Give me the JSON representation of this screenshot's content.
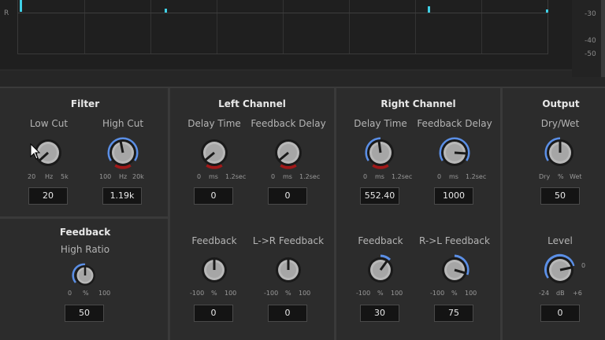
{
  "display": {
    "channel_label": "R",
    "scale_labels": [
      "-30",
      "-40",
      "-50"
    ]
  },
  "colors": {
    "accent_blue": "#5b8fe6",
    "accent_red": "#a01818",
    "marker_cyan": "#3fd0e6",
    "value_bg": "#141414"
  },
  "filter": {
    "title": "Filter",
    "low_cut": {
      "label": "Low Cut",
      "ticks": [
        "20",
        "Hz",
        "5k"
      ],
      "value": "20"
    },
    "high_cut": {
      "label": "High Cut",
      "ticks": [
        "100",
        "Hz",
        "20k"
      ],
      "value": "1.19k"
    }
  },
  "feedback_panel": {
    "title": "Feedback",
    "high_ratio": {
      "label": "High Ratio",
      "ticks": [
        "0",
        "%",
        "100"
      ],
      "value": "50"
    }
  },
  "left_channel": {
    "title": "Left Channel",
    "delay_time": {
      "label": "Delay Time",
      "ticks": [
        "0",
        "ms",
        "1.2sec"
      ],
      "value": "0"
    },
    "feedback_delay": {
      "label": "Feedback Delay",
      "ticks": [
        "0",
        "ms",
        "1.2sec"
      ],
      "value": "0"
    },
    "feedback": {
      "label": "Feedback",
      "ticks": [
        "-100",
        "%",
        "100"
      ],
      "value": "0"
    },
    "lr_feedback": {
      "label": "L->R Feedback",
      "ticks": [
        "-100",
        "%",
        "100"
      ],
      "value": "0"
    }
  },
  "right_channel": {
    "title": "Right Channel",
    "delay_time": {
      "label": "Delay Time",
      "ticks": [
        "0",
        "ms",
        "1.2sec"
      ],
      "value": "552.40"
    },
    "feedback_delay": {
      "label": "Feedback Delay",
      "ticks": [
        "0",
        "ms",
        "1.2sec"
      ],
      "value": "1000"
    },
    "feedback": {
      "label": "Feedback",
      "ticks": [
        "-100",
        "%",
        "100"
      ],
      "value": "30"
    },
    "rl_feedback": {
      "label": "R->L Feedback",
      "ticks": [
        "-100",
        "%",
        "100"
      ],
      "value": "75"
    }
  },
  "output": {
    "title": "Output",
    "dry_wet": {
      "label": "Dry/Wet",
      "ticks": [
        "Dry",
        "%",
        "Wet"
      ],
      "value": "50"
    },
    "level": {
      "label": "Level",
      "ticks": [
        "-24",
        "dB",
        "+6"
      ],
      "value": "0",
      "marker": "0"
    }
  }
}
